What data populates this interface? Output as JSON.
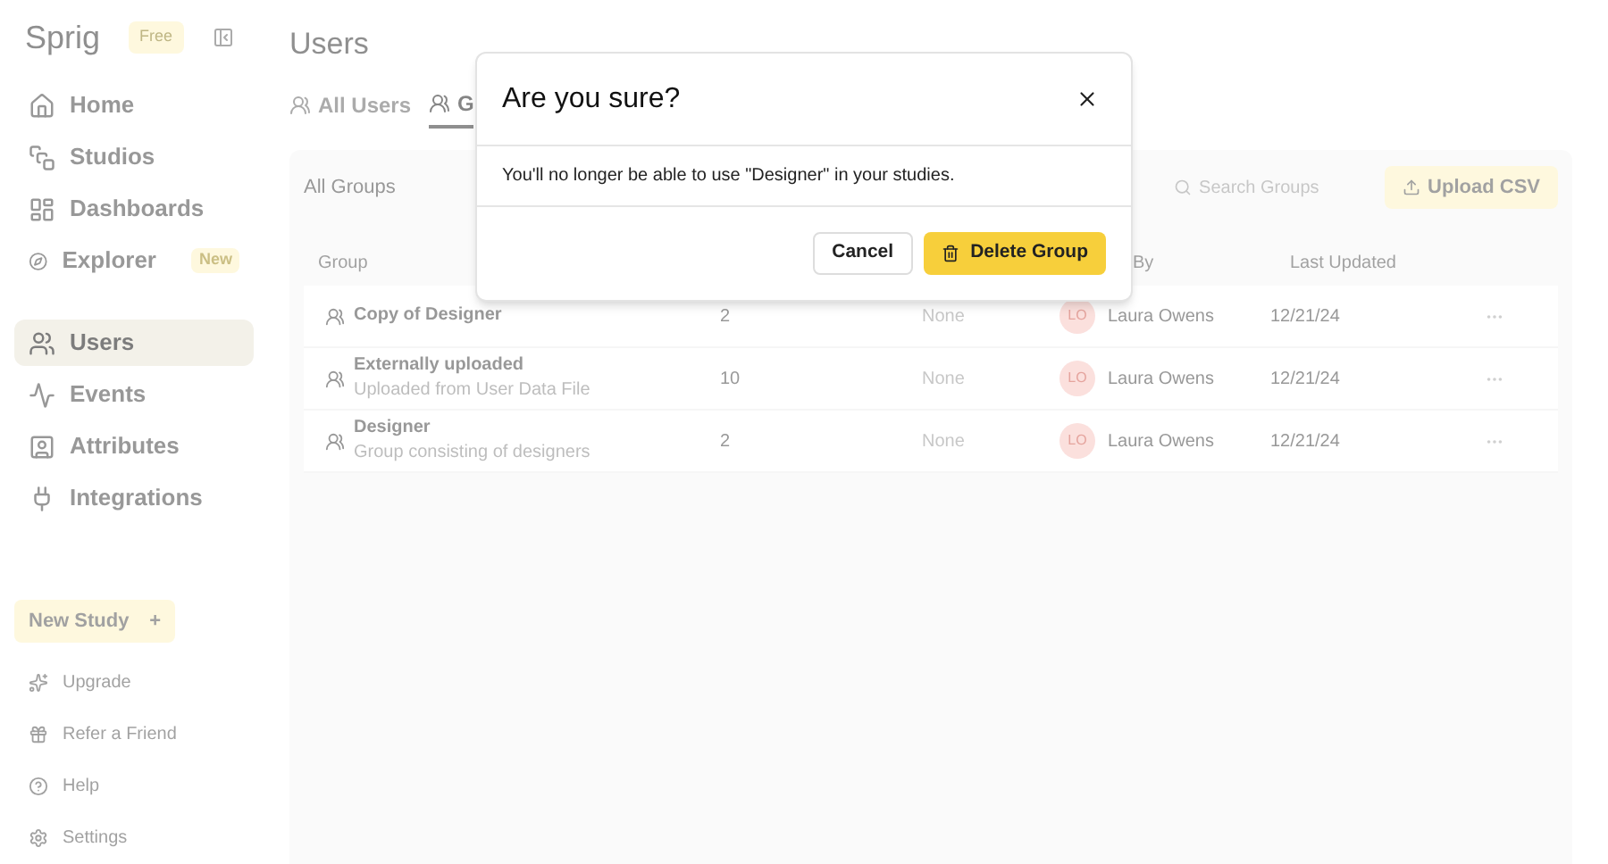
{
  "sidebar": {
    "logo": "Sprig",
    "plan_badge": "Free",
    "nav": [
      {
        "label": "Home",
        "selected": false
      },
      {
        "label": "Studios",
        "selected": false
      },
      {
        "label": "Dashboards",
        "selected": false
      },
      {
        "label": "Explorer",
        "selected": false,
        "badge": "New"
      }
    ],
    "nav_secondary": [
      {
        "label": "Users",
        "selected": true
      },
      {
        "label": "Events",
        "selected": false
      },
      {
        "label": "Attributes",
        "selected": false
      },
      {
        "label": "Integrations",
        "selected": false
      }
    ],
    "new_study": {
      "label": "New Study",
      "shortcut": "+"
    },
    "footer": [
      {
        "label": "Upgrade"
      },
      {
        "label": "Refer a Friend"
      },
      {
        "label": "Help"
      },
      {
        "label": "Settings"
      }
    ]
  },
  "page": {
    "title": "Users",
    "tabs": [
      {
        "label": "All Users",
        "selected": false
      },
      {
        "label": "G",
        "selected": true
      }
    ],
    "filter": "All Groups",
    "search": {
      "placeholder": "Search Groups"
    },
    "upload_button": "Upload CSV",
    "table": {
      "columns": [
        "Group",
        "By",
        "Last Updated"
      ],
      "rows": [
        {
          "name": "Copy of Designer",
          "count": "2",
          "type": "None",
          "initials": "LO",
          "owner": "Laura Owens",
          "updated": "12/21/24"
        },
        {
          "name": "Externally uploaded",
          "description": "Uploaded from User Data File",
          "count": "10",
          "type": "None",
          "initials": "LO",
          "owner": "Laura Owens",
          "updated": "12/21/24"
        },
        {
          "name": "Designer",
          "description": "Group consisting of designers",
          "count": "2",
          "type": "None",
          "initials": "LO",
          "owner": "Laura Owens",
          "updated": "12/21/24"
        }
      ]
    }
  },
  "dialog": {
    "title": "Are you sure?",
    "message": "You'll no longer be able to use \"Designer\" in your studies.",
    "buttons": [
      {
        "label": "Cancel",
        "kind": "secondary"
      },
      {
        "label": "Delete Group",
        "kind": "danger"
      }
    ]
  }
}
